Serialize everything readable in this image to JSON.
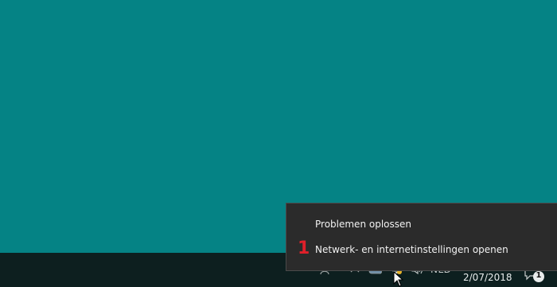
{
  "context_menu": {
    "items": [
      {
        "label": "Problemen oplossen"
      },
      {
        "label": "Netwerk- en internetinstellingen openen"
      }
    ]
  },
  "annotation": {
    "step": "1"
  },
  "taskbar": {
    "language": "NLD",
    "date": "2/07/2018",
    "notification_count": "1",
    "tray_icons": [
      "person-icon",
      "chevron-up-icon",
      "cloud-icon",
      "network-icon",
      "volume-icon"
    ]
  },
  "colors": {
    "desktop": "#058385",
    "taskbar": "#0d1f1f",
    "menu_background": "#2b2b2b",
    "menu_text": "#f2f2f2",
    "marker": "#e0202a"
  }
}
